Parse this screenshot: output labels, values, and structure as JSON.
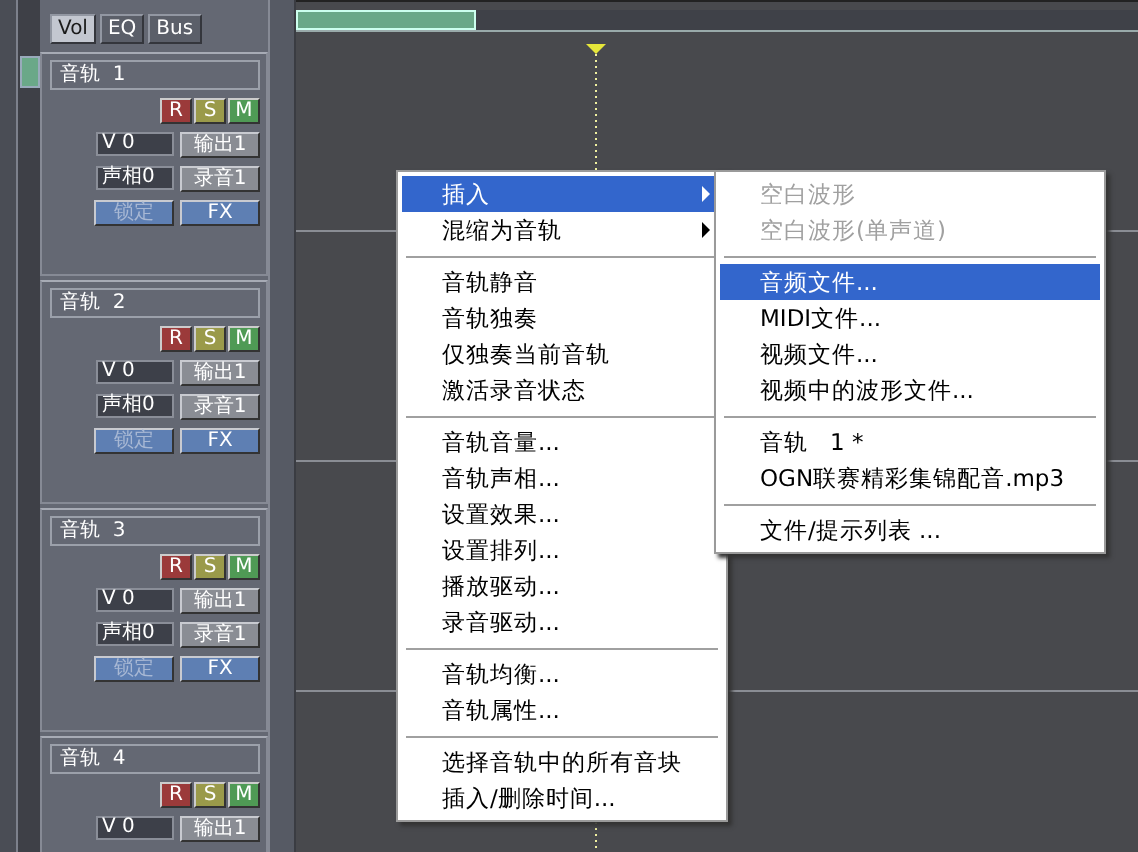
{
  "panel_tabs": [
    {
      "label": "Vol",
      "selected": true
    },
    {
      "label": "EQ",
      "selected": false
    },
    {
      "label": "Bus",
      "selected": false
    }
  ],
  "tracks": [
    {
      "title": "音轨  1",
      "toggles": [
        {
          "label": "R",
          "kind": "record"
        },
        {
          "label": "S",
          "kind": "solo"
        },
        {
          "label": "M",
          "kind": "mute"
        }
      ],
      "volume": "V 0",
      "output": "输出1",
      "pan": "声相0",
      "record_device": "录音1",
      "lock": {
        "label": "锁定",
        "disabled": true
      },
      "fx": "FX"
    },
    {
      "title": "音轨  2",
      "toggles": [
        {
          "label": "R",
          "kind": "record"
        },
        {
          "label": "S",
          "kind": "solo"
        },
        {
          "label": "M",
          "kind": "mute"
        }
      ],
      "volume": "V 0",
      "output": "输出1",
      "pan": "声相0",
      "record_device": "录音1",
      "lock": {
        "label": "锁定",
        "disabled": true
      },
      "fx": "FX"
    },
    {
      "title": "音轨  3",
      "toggles": [
        {
          "label": "R",
          "kind": "record"
        },
        {
          "label": "S",
          "kind": "solo"
        },
        {
          "label": "M",
          "kind": "mute"
        }
      ],
      "volume": "V 0",
      "output": "输出1",
      "pan": "声相0",
      "record_device": "录音1",
      "lock": {
        "label": "锁定",
        "disabled": true
      },
      "fx": "FX"
    },
    {
      "title": "音轨  4",
      "toggles": [
        {
          "label": "R",
          "kind": "record"
        },
        {
          "label": "S",
          "kind": "solo"
        },
        {
          "label": "M",
          "kind": "mute"
        }
      ],
      "volume": "V 0",
      "output": "输出1"
    }
  ],
  "context_menu": [
    {
      "kind": "item",
      "label": "插入",
      "submenu": true,
      "selected": true
    },
    {
      "kind": "item",
      "label": "混缩为音轨",
      "submenu": true,
      "selected": false
    },
    {
      "kind": "separator"
    },
    {
      "kind": "item",
      "label": "音轨静音",
      "submenu": false,
      "selected": false
    },
    {
      "kind": "item",
      "label": "音轨独奏",
      "submenu": false,
      "selected": false
    },
    {
      "kind": "item",
      "label": "仅独奏当前音轨",
      "submenu": false,
      "selected": false
    },
    {
      "kind": "item",
      "label": "激活录音状态",
      "submenu": false,
      "selected": false
    },
    {
      "kind": "separator"
    },
    {
      "kind": "item",
      "label": "音轨音量...",
      "submenu": false,
      "selected": false
    },
    {
      "kind": "item",
      "label": "音轨声相...",
      "submenu": false,
      "selected": false
    },
    {
      "kind": "item",
      "label": "设置效果...",
      "submenu": false,
      "selected": false
    },
    {
      "kind": "item",
      "label": "设置排列...",
      "submenu": false,
      "selected": false
    },
    {
      "kind": "item",
      "label": "播放驱动...",
      "submenu": false,
      "selected": false
    },
    {
      "kind": "item",
      "label": "录音驱动...",
      "submenu": false,
      "selected": false
    },
    {
      "kind": "separator"
    },
    {
      "kind": "item",
      "label": "音轨均衡...",
      "submenu": false,
      "selected": false
    },
    {
      "kind": "item",
      "label": "音轨属性...",
      "submenu": false,
      "selected": false
    },
    {
      "kind": "separator"
    },
    {
      "kind": "item",
      "label": "选择音轨中的所有音块",
      "submenu": false,
      "selected": false
    },
    {
      "kind": "item",
      "label": "插入/删除时间...",
      "submenu": false,
      "selected": false
    }
  ],
  "insert_submenu": [
    {
      "kind": "item",
      "label": "空白波形",
      "disabled": true,
      "selected": false
    },
    {
      "kind": "item",
      "label": "空白波形(单声道)",
      "disabled": true,
      "selected": false
    },
    {
      "kind": "separator"
    },
    {
      "kind": "item",
      "label": "音频文件...",
      "disabled": false,
      "selected": true
    },
    {
      "kind": "item",
      "label": "MIDI文件...",
      "disabled": false,
      "selected": false
    },
    {
      "kind": "item",
      "label": "视频文件...",
      "disabled": false,
      "selected": false
    },
    {
      "kind": "item",
      "label": "视频中的波形文件...",
      "disabled": false,
      "selected": false
    },
    {
      "kind": "separator"
    },
    {
      "kind": "item",
      "label": "音轨   1 *",
      "disabled": false,
      "selected": false
    },
    {
      "kind": "item",
      "label": "OGN联赛精彩集锦配音.mp3",
      "disabled": false,
      "selected": false
    },
    {
      "kind": "separator"
    },
    {
      "kind": "item",
      "label": "文件/提示列表 ...",
      "disabled": false,
      "selected": false
    }
  ]
}
